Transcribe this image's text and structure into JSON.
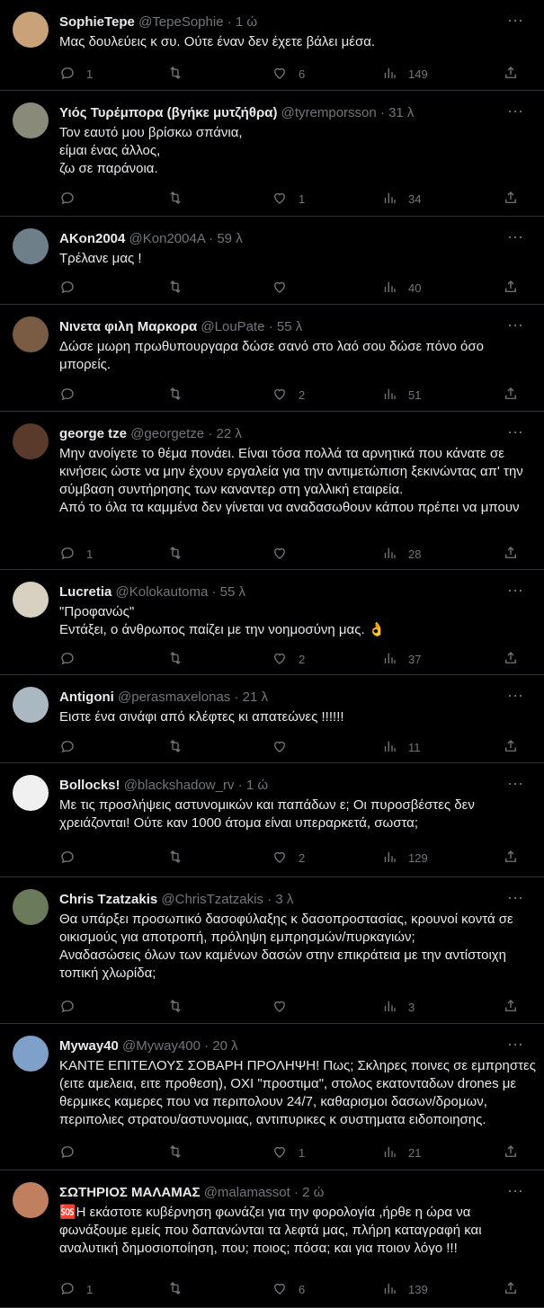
{
  "tweets": [
    {
      "name": "SophieTepe",
      "handle": "@TepeSophie",
      "time": "1 ώ",
      "text": "Μας δουλεύεις κ συ. Ούτε έναν δεν έχετε βάλει μέσα.",
      "replies": "1",
      "retweets": "",
      "likes": "6",
      "views": "149",
      "avatar": "#c9a27a"
    },
    {
      "name": "Υιός Τυρέμπορα (βγήκε μυτζήθρα)",
      "handle": "@tyremporsson",
      "time": "31 λ",
      "text": "Τον εαυτό μου βρίσκω σπάνια,\nείμαι ένας άλλος,\nζω σε παράνοια.",
      "replies": "",
      "retweets": "",
      "likes": "1",
      "views": "34",
      "avatar": "#8a8a7a"
    },
    {
      "name": "AKon2004",
      "handle": "@Kon2004A",
      "time": "59 λ",
      "text": "Τρέλανε μας !",
      "replies": "",
      "retweets": "",
      "likes": "",
      "views": "40",
      "avatar": "#6f7f8a"
    },
    {
      "name": "Νινετα φιλη Μαρκορα",
      "handle": "@LouPate",
      "time": "55 λ",
      "text": "Δώσε μωρη πρωθυπουργαρα δώσε σανό στο λαό σου δώσε πόνο όσο μπορείς.",
      "replies": "",
      "retweets": "",
      "likes": "2",
      "views": "51",
      "avatar": "#7a5c45"
    },
    {
      "name": "george tze",
      "handle": "@georgetze",
      "time": "22 λ",
      "text": "Μην ανοίγετε το θέμα πονάει. Είναι τόσα πολλά τα αρνητικά που κάνατε σε κινήσεις ώστε να μην έχουν εργαλεία για την αντιμετώπιση ξεκινώντας απ' την σύμβαση συντήρησης των καναντερ στη γαλλική εταιρεία.\nΑπό το όλα τα καμμένα δεν γίνεται να αναδασωθουν κάπου πρέπει να μπουν",
      "replies": "1",
      "retweets": "",
      "likes": "",
      "views": "28",
      "avatar": "#5a3a2a"
    },
    {
      "name": "Lucretia",
      "handle": "@Kolokautoma",
      "time": "55 λ",
      "text": "\"Προφανώς\"\nΕντάξει, ο άνθρωπος παίζει με την νοημοσύνη μας. 👌",
      "replies": "",
      "retweets": "",
      "likes": "2",
      "views": "37",
      "avatar": "#d8d0c0"
    },
    {
      "name": "Antigoni",
      "handle": "@perasmaxelonas",
      "time": "21 λ",
      "text": "Ειστε ένα σινάφι από κλέφτες κι απατεώνες !!!!!!",
      "replies": "",
      "retweets": "",
      "likes": "",
      "views": "11",
      "avatar": "#aab8c2"
    },
    {
      "name": "Bollocks!",
      "handle": "@blackshadow_rv",
      "time": "1 ώ",
      "text": "Με τις προσλήψεις αστυνομικών και παπάδων ε; Οι πυροσβέστες δεν χρειάζονται! Ούτε καν 1000 άτομα είναι υπεραρκετά, σωστα;",
      "replies": "",
      "retweets": "",
      "likes": "2",
      "views": "129",
      "avatar": "#f0f0f0"
    },
    {
      "name": "Chris Tzatzakis",
      "handle": "@ChrisTzatzakis",
      "time": "3 λ",
      "text": "Θα υπάρξει προσωπικό δασοφύλαξης κ δασοπροστασίας, κρουνοί κοντά σε οικισμούς για αποτροπή, πρόληψη εμπρησμών/πυρκαγιών;\nΑναδασώσεις όλων των καμένων δασών στην επικράτεια με την αντίστοιχη τοπική χλωρίδα;",
      "replies": "",
      "retweets": "",
      "likes": "",
      "views": "3",
      "avatar": "#6a7a5a"
    },
    {
      "name": "Myway40",
      "handle": "@Myway400",
      "time": "20 λ",
      "text": "ΚΑΝΤΕ ΕΠΙΤΕΛΟΥΣ ΣΟΒΑΡΗ ΠΡΟΛΗΨΗ! Πως; Σκληρες ποινες σε εμπρηστες (ειτε αμελεια, ειτε προθεση), ΟΧΙ \"προστιμα\", στολος εκατονταδων drones με θερμικες καμερες που να περιπολουν 24/7, καθαρισμοι δασων/δρομων, περιπολιες στρατου/αστυνομιας, αντιπυρικες κ συστηματα ειδοποιησης.",
      "replies": "",
      "retweets": "",
      "likes": "1",
      "views": "21",
      "avatar": "#7fa0c8"
    },
    {
      "name": "ΣΩΤΗΡΙΟΣ ΜΑΛΑΜΑΣ",
      "handle": "@malamassot",
      "time": "2 ώ",
      "text": "🆘Η εκάστοτε κυβέρνηση φωνάζει για την φορολογία ,ήρθε η ώρα να φωνάξουμε εμείς που δαπανώνται τα λεφτά μας, πλήρη καταγραφή και αναλυτική δημοσιοποίηση, που; ποιος; πόσα; και για ποιον λόγο !!!",
      "replies": "1",
      "retweets": "",
      "likes": "6",
      "views": "139",
      "avatar": "#c08060"
    }
  ],
  "icons": {
    "more": "more-icon",
    "reply": "reply-icon",
    "retweet": "retweet-icon",
    "like": "heart-icon",
    "views": "views-icon",
    "share": "share-icon"
  }
}
